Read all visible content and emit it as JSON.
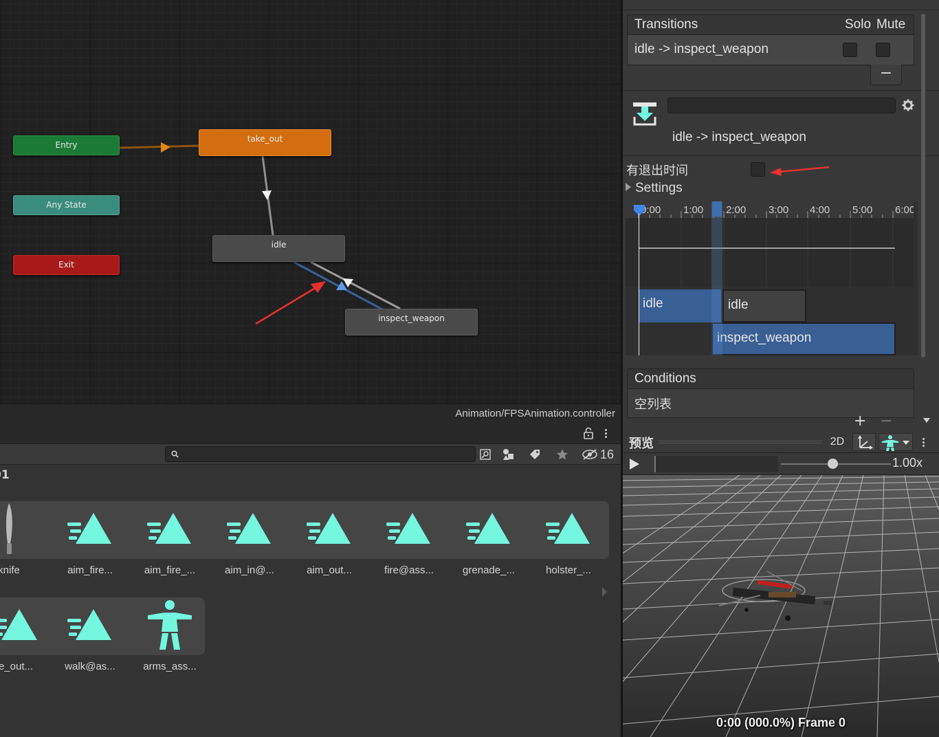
{
  "graph": {
    "nodes": {
      "entry": "Entry",
      "any_state": "Any State",
      "exit": "Exit",
      "take_out": "take_out",
      "idle": "idle",
      "inspect_weapon": "inspect_weapon"
    },
    "controller_path": "Animation/FPSAnimation.controller"
  },
  "project": {
    "search": {
      "value": "",
      "placeholder": ""
    },
    "hidden_count": "16",
    "breadcrumb": "01",
    "row1": [
      {
        "label": "knife",
        "icon": "knife-model-icon"
      },
      {
        "label": "aim_fire...",
        "icon": "animation-clip-icon"
      },
      {
        "label": "aim_fire_...",
        "icon": "animation-clip-icon"
      },
      {
        "label": "aim_in@...",
        "icon": "animation-clip-icon"
      },
      {
        "label": "aim_out...",
        "icon": "animation-clip-icon"
      },
      {
        "label": "fire@ass...",
        "icon": "animation-clip-icon"
      },
      {
        "label": "grenade_...",
        "icon": "animation-clip-icon"
      },
      {
        "label": "holster_...",
        "icon": "animation-clip-icon"
      }
    ],
    "row2": [
      {
        "label": "e_out...",
        "icon": "animation-clip-icon"
      },
      {
        "label": "walk@as...",
        "icon": "animation-clip-icon"
      },
      {
        "label": "arms_ass...",
        "icon": "avatar-icon"
      }
    ]
  },
  "inspector": {
    "transitions_header": "Transitions",
    "solo_label": "Solo",
    "mute_label": "Mute",
    "transition_item": "idle -> inspect_weapon",
    "minus_label": "−",
    "name_field": "",
    "transition_title": "idle -> inspect_weapon",
    "has_exit_time_label": "有退出时间",
    "settings_label": "Settings",
    "timeline": {
      "ticks": [
        "0:00",
        "1:00",
        "2:00",
        "3:00",
        "4:00",
        "5:00",
        "6:00"
      ],
      "clips": {
        "source_a": "idle",
        "source_b": "idle",
        "destination": "inspect_weapon"
      }
    },
    "conditions_header": "Conditions",
    "conditions_empty": "空列表",
    "plus_label": "+",
    "minus2_label": "−"
  },
  "preview": {
    "title": "预览",
    "mode_2d": "2D",
    "speed": "1.00x",
    "frame_info": "0:00 (000.0%) Frame 0"
  },
  "colors": {
    "entry": "#1a7a36",
    "any_state": "#3a8c7c",
    "exit": "#a81a1a",
    "take_out": "#d36e0f",
    "state": "#4a4a4a",
    "accent_blue": "#3a5f95",
    "icon_cyan": "#74f6df",
    "annotation_red": "#e8312f"
  }
}
